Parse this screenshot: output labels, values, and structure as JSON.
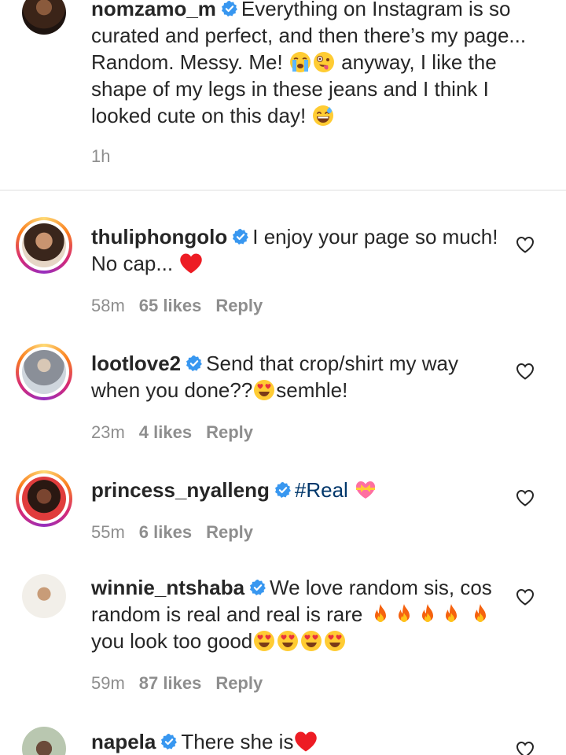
{
  "caption": {
    "username": "nomzamo_m",
    "text_1": "Everything on Instagram is so curated and perfect, and then there’s my page... Random. Messy. Me!",
    "text_2": "anyway, I like the shape of my legs in these jeans and I think I looked cute on this day!",
    "time": "1h"
  },
  "comments": [
    {
      "username": "thuliphongolo",
      "text": "I enjoy your page so much! No cap...",
      "time": "58m",
      "likes": "65 likes",
      "reply": "Reply"
    },
    {
      "username": "lootlove2",
      "text": "Send that crop/shirt my way when you done??",
      "text_2": "semhle!",
      "time": "23m",
      "likes": "4 likes",
      "reply": "Reply"
    },
    {
      "username": "princess_nyalleng",
      "text": "#Real",
      "time": "55m",
      "likes": "6 likes",
      "reply": "Reply"
    },
    {
      "username": "winnie_ntshaba",
      "text": "We love random sis, cos random is real and real is rare",
      "text_2": "you look too good",
      "time": "59m",
      "likes": "87 likes",
      "reply": "Reply"
    },
    {
      "username": "napela",
      "text": "There she is"
    }
  ],
  "colors": {
    "verified": "#3897f0",
    "meta": "#8e8e8e",
    "text": "#262626",
    "hashtag": "#00376b",
    "heart_red": "#ed1c24"
  },
  "icons": {
    "verified": "verified-badge-icon",
    "like": "heart-outline-icon"
  }
}
